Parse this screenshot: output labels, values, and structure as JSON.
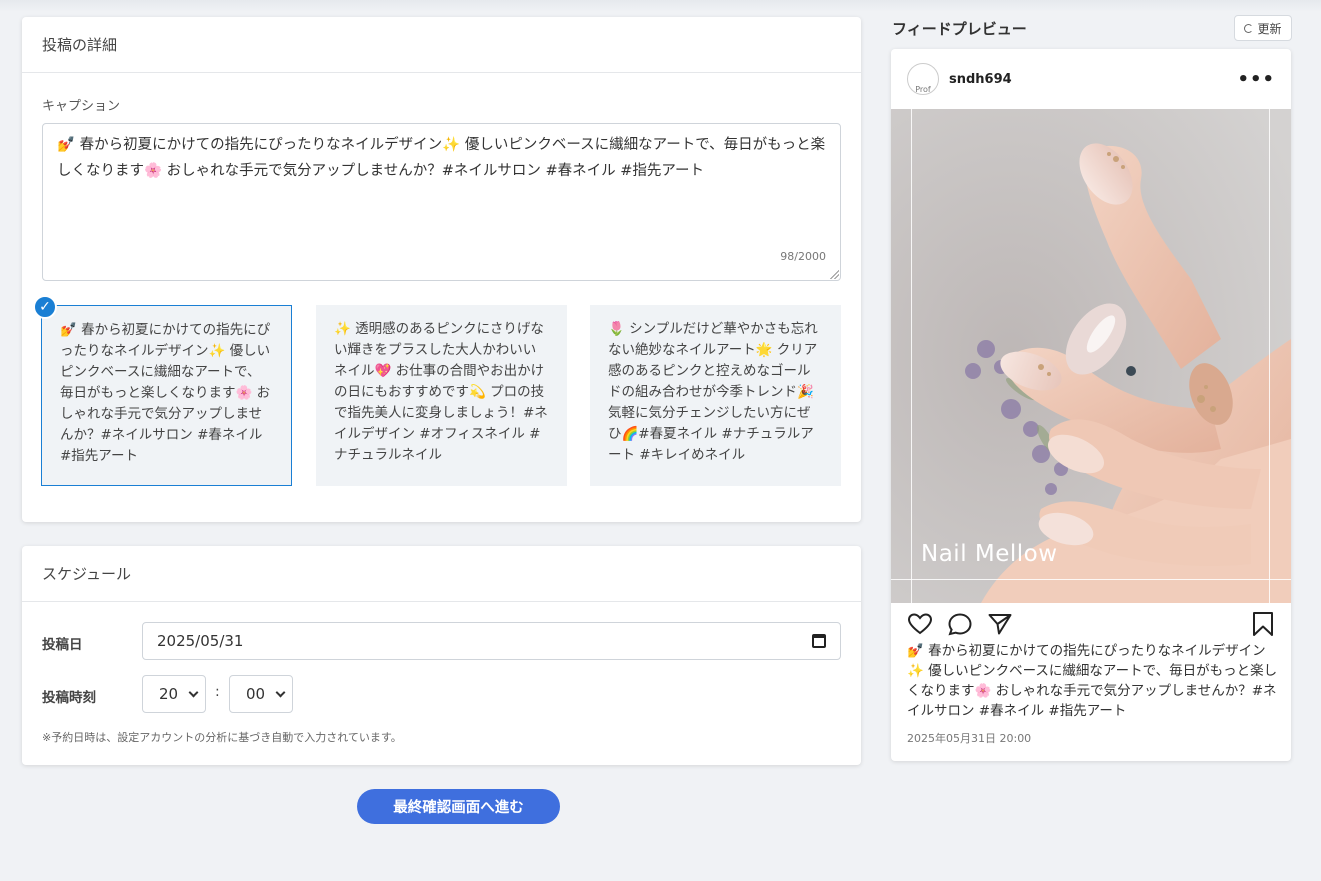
{
  "details": {
    "header": "投稿の詳細",
    "caption_label": "キャプション",
    "caption_text": "💅 春から初夏にかけての指先にぴったりなネイルデザイン✨ 優しいピンクベースに繊細なアートで、毎日がもっと楽しくなります🌸 おしゃれな手元で気分アップしませんか？#ネイルサロン #春ネイル #指先アート",
    "char_count": "98/2000",
    "options": [
      {
        "text": "💅 春から初夏にかけての指先にぴったりなネイルデザイン✨ 優しいピンクベースに繊細なアートで、毎日がもっと楽しくなります🌸 おしゃれな手元で気分アップしませんか？#ネイルサロン #春ネイル #指先アート",
        "selected": true
      },
      {
        "text": "✨ 透明感のあるピンクにさりげない輝きをプラスした大人かわいいネイル💖 お仕事の合間やお出かけの日にもおすすめです💫 プロの技で指先美人に変身しましょう！#ネイルデザイン #オフィスネイル #ナチュラルネイル",
        "selected": false
      },
      {
        "text": "🌷 シンプルだけど華やかさも忘れない絶妙なネイルアート🌟 クリア感のあるピンクと控えめなゴールドの組み合わせが今季トレンド🎉 気軽に気分チェンジしたい方にぜひ🌈#春夏ネイル #ナチュラルアート #キレイめネイル",
        "selected": false
      }
    ],
    "check_mark": "✓"
  },
  "schedule": {
    "header": "スケジュール",
    "date_label": "投稿日",
    "date_value": "2025/05/31",
    "time_label": "投稿時刻",
    "hour_value": "20",
    "minute_value": "00",
    "colon": ":",
    "note": "※予約日時は、設定アカウントの分析に基づき自動で入力されています。"
  },
  "proceed_button": "最終確認画面へ進む",
  "preview": {
    "title": "フィードプレビュー",
    "refresh_label": "更新",
    "avatar_alt": "Prof",
    "username": "sndh694",
    "more_icon": "•••",
    "image_text": "Nail Mellow",
    "caption": "💅 春から初夏にかけての指先にぴったりなネイルデザイン✨ 優しいピンクベースに繊細なアートで、毎日がもっと楽しくなります🌸 おしゃれな手元で気分アップしませんか？#ネイルサロン #春ネイル #指先アート",
    "date": "2025年05月31日 20:00"
  },
  "colors": {
    "accent": "#1a7fd4",
    "primary_button": "#3f6fde"
  },
  "icons": [
    "check-icon",
    "calendar-icon",
    "chevron-down-icon",
    "refresh-icon",
    "more-icon",
    "heart-icon",
    "comment-icon",
    "share-icon",
    "bookmark-icon"
  ]
}
